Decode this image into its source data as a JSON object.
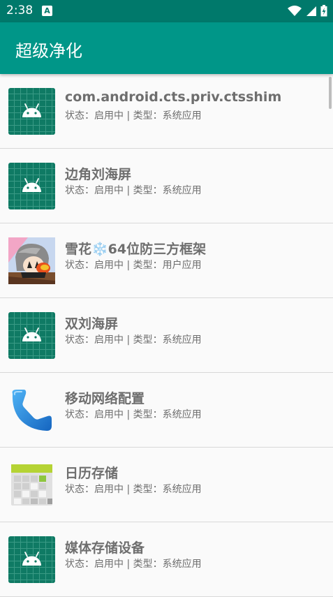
{
  "status_bar": {
    "time": "2:38",
    "notification_icon": "A",
    "icons": [
      "wifi-icon",
      "signal-icon",
      "battery-icon"
    ]
  },
  "app_bar": {
    "title": "超级净化",
    "color": "#009688"
  },
  "apps": [
    {
      "name": "com.android.cts.priv.ctsshim",
      "status": "状态：启用中 | 类型：系统应用",
      "icon": "android-icon"
    },
    {
      "name": "边角刘海屏",
      "status": "状态：启用中 | 类型：系统应用",
      "icon": "android-icon"
    },
    {
      "name": "雪花❄️64位防三方框架",
      "status": "状态：启用中 | 类型：用户应用",
      "icon": "avatar-icon"
    },
    {
      "name": "双刘海屏",
      "status": "状态：启用中 | 类型：系统应用",
      "icon": "android-icon"
    },
    {
      "name": "移动网络配置",
      "status": "状态：启用中 | 类型：系统应用",
      "icon": "phone-icon"
    },
    {
      "name": "日历存储",
      "status": "状态：启用中 | 类型：系统应用",
      "icon": "calendar-icon"
    },
    {
      "name": "媒体存储设备",
      "status": "状态：启用中 | 类型：系统应用",
      "icon": "android-icon"
    }
  ]
}
